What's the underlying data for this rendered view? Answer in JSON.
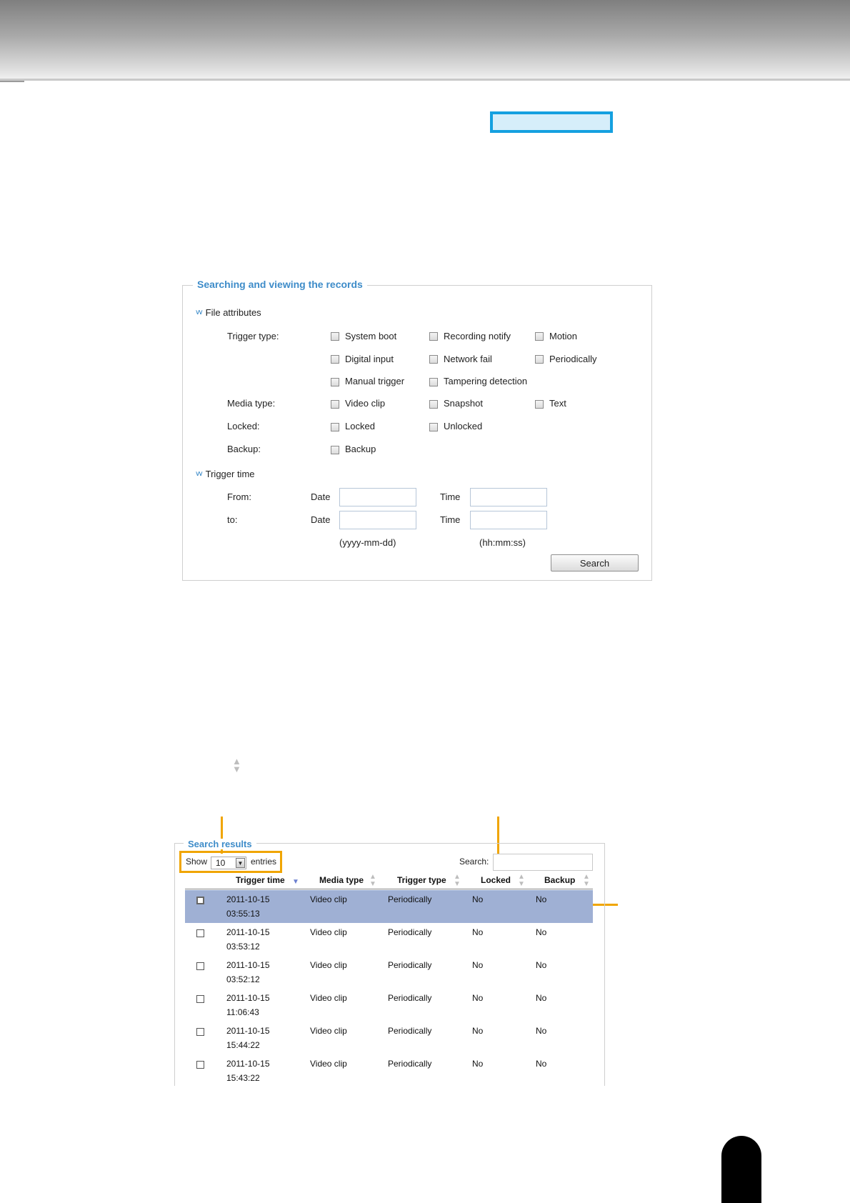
{
  "search_panel": {
    "legend": "Searching and viewing the records",
    "file_attributes": {
      "heading": "File attributes",
      "trigger_type_label": "Trigger type:",
      "trigger_types": [
        "System boot",
        "Recording notify",
        "Motion",
        "Digital input",
        "Network fail",
        "Periodically",
        "Manual trigger",
        "Tampering detection"
      ],
      "media_type_label": "Media type:",
      "media_types": [
        "Video clip",
        "Snapshot",
        "Text"
      ],
      "locked_label": "Locked:",
      "locked_options": [
        "Locked",
        "Unlocked"
      ],
      "backup_label": "Backup:",
      "backup_options": [
        "Backup"
      ]
    },
    "trigger_time": {
      "heading": "Trigger time",
      "from_label": "From:",
      "to_label": "to:",
      "date_label": "Date",
      "time_label": "Time",
      "date_hint": "(yyyy-mm-dd)",
      "time_hint": "(hh:mm:ss)"
    },
    "search_button": "Search"
  },
  "results_panel": {
    "legend": "Search results",
    "show_label": "Show",
    "entries_value": "10",
    "entries_label": "entries",
    "search_label": "Search:",
    "columns": [
      "Trigger time",
      "Media type",
      "Trigger type",
      "Locked",
      "Backup"
    ],
    "rows": [
      {
        "date": "2011-10-15",
        "time": "03:55:13",
        "media": "Video clip",
        "trigger": "Periodically",
        "locked": "No",
        "backup": "No",
        "selected": true
      },
      {
        "date": "2011-10-15",
        "time": "03:53:12",
        "media": "Video clip",
        "trigger": "Periodically",
        "locked": "No",
        "backup": "No",
        "selected": false
      },
      {
        "date": "2011-10-15",
        "time": "03:52:12",
        "media": "Video clip",
        "trigger": "Periodically",
        "locked": "No",
        "backup": "No",
        "selected": false
      },
      {
        "date": "2011-10-15",
        "time": "11:06:43",
        "media": "Video clip",
        "trigger": "Periodically",
        "locked": "No",
        "backup": "No",
        "selected": false
      },
      {
        "date": "2011-10-15",
        "time": "15:44:22",
        "media": "Video clip",
        "trigger": "Periodically",
        "locked": "No",
        "backup": "No",
        "selected": false
      },
      {
        "date": "2011-10-15",
        "time": "15:43:22",
        "media": "Video clip",
        "trigger": "Periodically",
        "locked": "No",
        "backup": "No",
        "selected": false
      }
    ]
  },
  "colors": {
    "accent_blue": "#3e8cc9",
    "highlight_border": "#14a0e0",
    "callout_orange": "#f0a500",
    "selected_row": "#9fb0d4"
  },
  "icons": {
    "section_toggle": "double-chevron-down-icon",
    "sort": "sort-up-down-icon",
    "sort_active": "sort-desc-icon"
  }
}
